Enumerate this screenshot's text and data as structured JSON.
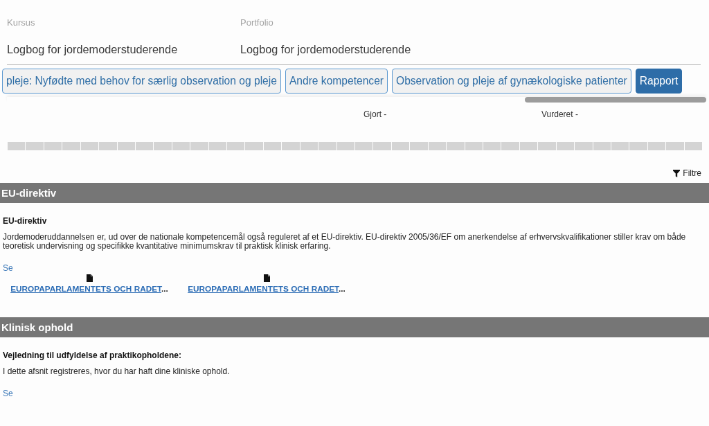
{
  "header": {
    "fields": [
      {
        "label": "Kursus",
        "value": "Logbog for jordemoderstuderende"
      },
      {
        "label": "Portfolio",
        "value": "Logbog for jordemoderstuderende"
      }
    ]
  },
  "tabs": [
    {
      "label": "pleje: Nyfødte med behov for særlig observation og pleje",
      "selected": false
    },
    {
      "label": "Andre kompetencer",
      "selected": false
    },
    {
      "label": "Observation og pleje af gynækologiske patienter",
      "selected": false
    },
    {
      "label": "Rapport",
      "selected": true
    }
  ],
  "progress": {
    "done_label": "Gjort -",
    "assessed_label": "Vurderet -"
  },
  "filter_button": {
    "label": "Filtre"
  },
  "sections": [
    {
      "title": "EU-direktiv",
      "heading": "EU-direktiv",
      "text": "Jordemoderuddannelsen er, ud over de nationale kompetencemål også reguleret af et EU-direktiv. EU-direktiv 2005/36/EF om anerkendelse af erhvervskvalifikationer stiller krav om både teoretisk undervisning og specifikke kvantitative minimumskrav til praktisk klinisk erfaring.",
      "link": "Se",
      "attachments": [
        {
          "label": "EUROPAPARLAMENTETS OCH RADET",
          "overflow": "..."
        },
        {
          "label": "EUROPAPARLAMENTETS OCH RADET",
          "overflow": "..."
        }
      ]
    },
    {
      "title": "Klinisk ophold",
      "heading": "Vejledning til udfyldelse af praktikopholdene:",
      "text": "I dette afsnit registreres, hvor du har haft dine kliniske ophold.",
      "link": "Se"
    }
  ]
}
